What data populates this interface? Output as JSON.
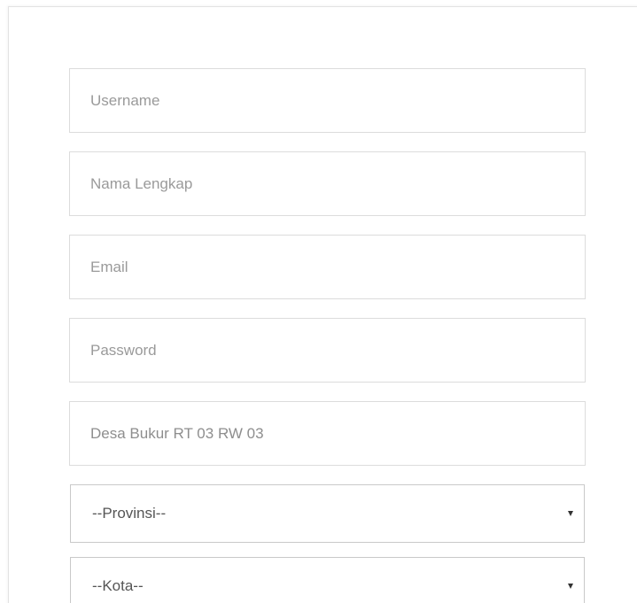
{
  "form": {
    "username": {
      "placeholder": "Username",
      "value": ""
    },
    "full_name": {
      "placeholder": "Nama Lengkap",
      "value": ""
    },
    "email": {
      "placeholder": "Email",
      "value": ""
    },
    "password": {
      "placeholder": "Password",
      "value": ""
    },
    "address": {
      "placeholder": "",
      "value": "Desa Bukur RT 03 RW 03"
    },
    "province": {
      "selected": "--Provinsi--"
    },
    "city": {
      "selected": "--Kota--"
    }
  },
  "colors": {
    "border": "#dcdcdc",
    "select_border": "#c9c9c9",
    "placeholder": "#9a9a9a",
    "text": "#555555"
  },
  "icons": {
    "select_caret": "caret-down-icon"
  }
}
